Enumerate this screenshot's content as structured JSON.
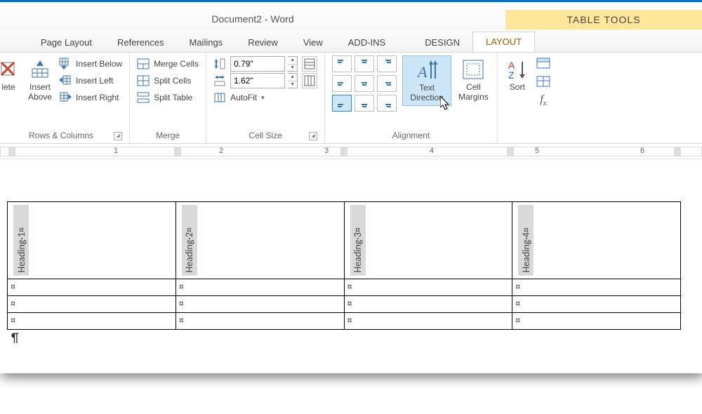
{
  "title": {
    "doc": "Document2 - Word",
    "context": "TABLE TOOLS"
  },
  "tabs": {
    "page_layout": "Page Layout",
    "references": "References",
    "mailings": "Mailings",
    "review": "Review",
    "view": "View",
    "addins": "ADD-INS",
    "design": "DESIGN",
    "layout": "LAYOUT"
  },
  "ribbon": {
    "rows_columns": {
      "delete": "lete",
      "insert_above": "Insert\nAbove",
      "insert_below": "Insert Below",
      "insert_left": "Insert Left",
      "insert_right": "Insert Right",
      "label": "Rows & Columns"
    },
    "merge": {
      "merge_cells": "Merge Cells",
      "split_cells": "Split Cells",
      "split_table": "Split Table",
      "label": "Merge"
    },
    "cell_size": {
      "height_value": "0.79\"",
      "width_value": "1.62\"",
      "autofit": "AutoFit",
      "label": "Cell Size"
    },
    "alignment": {
      "text_direction": "Text\nDirection",
      "cell_margins": "Cell\nMargins",
      "label": "Alignment"
    },
    "data": {
      "sort": "Sort"
    }
  },
  "ruler": {
    "n1": "1",
    "n2": "2",
    "n3": "3",
    "n4": "4",
    "n5": "5",
    "n6": "6"
  },
  "table": {
    "headers": [
      "Heading·1¤",
      "Heading·2¤",
      "Heading·3¤",
      "Heading·4¤"
    ],
    "cellmark": "¤",
    "rows": 3,
    "cols": 4
  },
  "para_mark": "¶"
}
